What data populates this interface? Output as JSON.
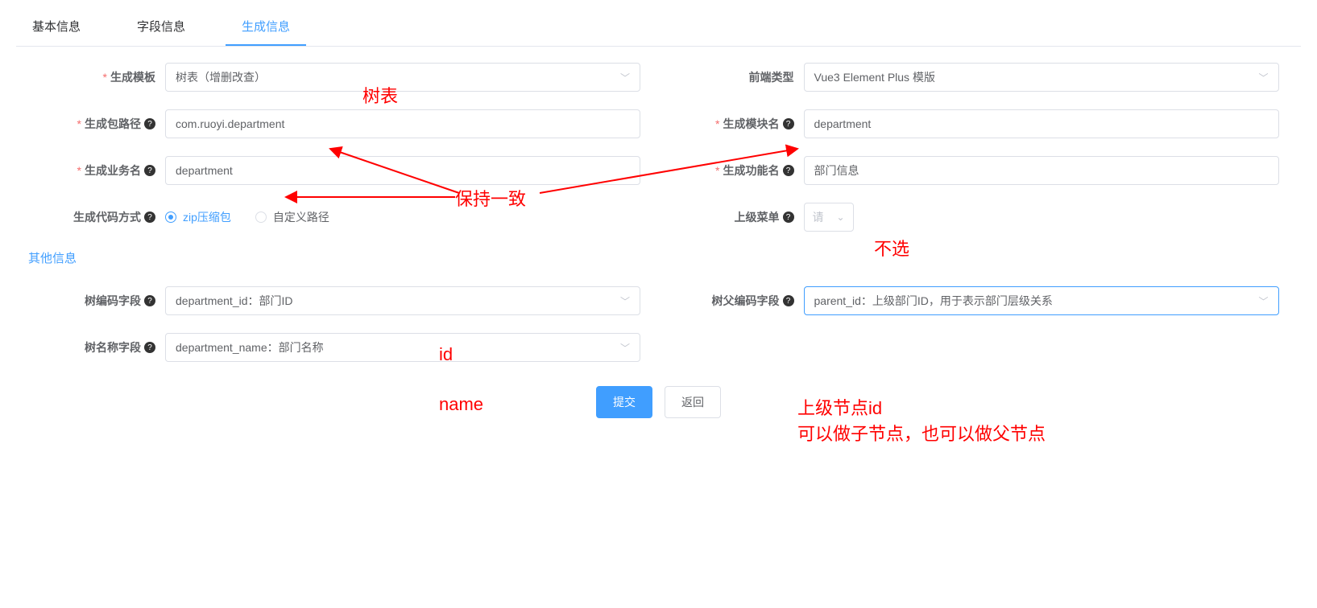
{
  "tabs": {
    "basic": "基本信息",
    "fields": "字段信息",
    "generate": "生成信息"
  },
  "form": {
    "template_label": "生成模板",
    "template_value": "树表（增删改查）",
    "frontend_label": "前端类型",
    "frontend_value": "Vue3 Element Plus 模版",
    "package_label": "生成包路径",
    "package_value": "com.ruoyi.department",
    "module_label": "生成模块名",
    "module_value": "department",
    "business_label": "生成业务名",
    "business_value": "department",
    "function_label": "生成功能名",
    "function_value": "部门信息",
    "codegen_label": "生成代码方式",
    "radio_zip": "zip压缩包",
    "radio_custom": "自定义路径",
    "parent_menu_label": "上级菜单",
    "parent_menu_placeholder": "请"
  },
  "section_other": "其他信息",
  "tree": {
    "code_field_label": "树编码字段",
    "code_field_value": "department_id：部门ID",
    "parent_field_label": "树父编码字段",
    "parent_field_value": "parent_id：上级部门ID，用于表示部门层级关系",
    "name_field_label": "树名称字段",
    "name_field_value": "department_name：部门名称"
  },
  "buttons": {
    "submit": "提交",
    "back": "返回"
  },
  "annotations": {
    "a1": "树表",
    "a2": "保持一致",
    "a3": "不选",
    "a4": "id",
    "a5": "name",
    "a6_line1": "上级节点id",
    "a6_line2": "可以做子节点，也可以做父节点"
  }
}
